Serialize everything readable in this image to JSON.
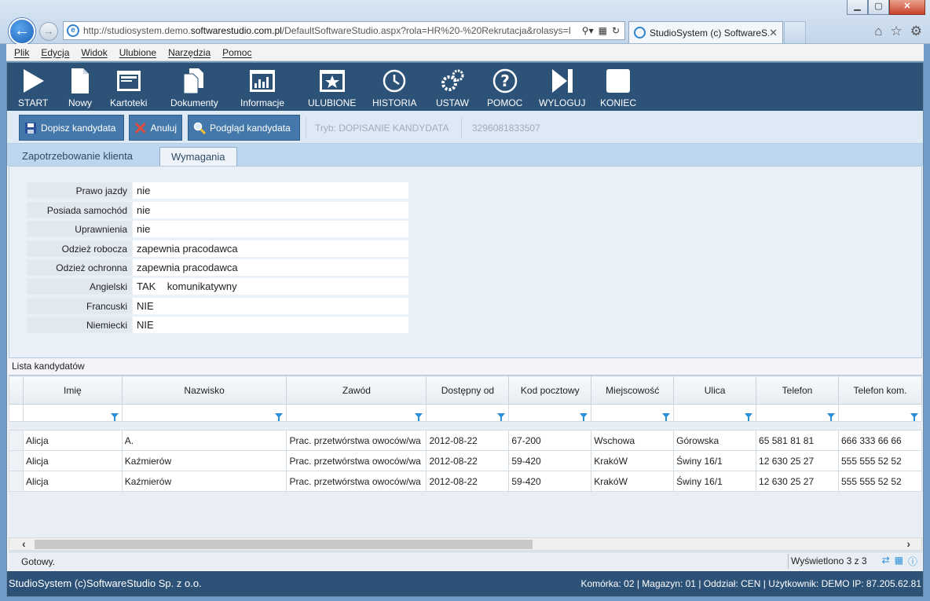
{
  "browser": {
    "url_prefix": "http://studiosystem.demo.",
    "url_domain": "softwarestudio.com.pl",
    "url_suffix": "/DefaultSoftwareStudio.aspx?rola=HR%20-%20Rekrutacja&rolasys=I",
    "tab_title": "StudioSystem (c) SoftwareS...",
    "tab_close": "✕",
    "minimize": "▁",
    "maximize": "▢",
    "close": "✕"
  },
  "menu": [
    "Plik",
    "Edycja",
    "Widok",
    "Ulubione",
    "Narzędzia",
    "Pomoc"
  ],
  "toolbar": [
    "START",
    "Nowy",
    "Kartoteki",
    "Dokumenty",
    "Informacje",
    "ULUBIONE",
    "HISTORIA",
    "USTAW",
    "POMOC",
    "WYLOGUJ",
    "KONIEC"
  ],
  "actions": {
    "add_candidate": "Dopisz kandydata",
    "cancel": "Anuluj",
    "preview": "Podgląd kandydata",
    "mode": "Tryb: DOPISANIE KANDYDATA",
    "record_id": "3296081833507"
  },
  "tabs": [
    "Zapotrzebowanie klienta",
    "Wymagania"
  ],
  "requirements": [
    {
      "label": "Prawo jazdy",
      "value": "nie"
    },
    {
      "label": "Posiada samochód",
      "value": "nie"
    },
    {
      "label": "Uprawnienia",
      "value": "nie"
    },
    {
      "label": "Odzież robocza",
      "value": "zapewnia pracodawca"
    },
    {
      "label": "Odzież ochronna",
      "value": "zapewnia pracodawca"
    },
    {
      "label": "Angielski",
      "value": "TAK    komunikatywny"
    },
    {
      "label": "Francuski",
      "value": "NIE"
    },
    {
      "label": "Niemiecki",
      "value": "NIE"
    }
  ],
  "list_title": "Lista kandydatów",
  "grid": {
    "columns": [
      "Imię",
      "Nazwisko",
      "Zawód",
      "Dostępny od",
      "Kod pocztowy",
      "Miejscowość",
      "Ulica",
      "Telefon",
      "Telefon kom."
    ],
    "rows": [
      [
        "Alicja",
        "A.",
        "Prac. przetwórstwa owoców/wa",
        "2012-08-22",
        "67-200",
        "Wschowa",
        "Górowska",
        "65 581 81 81",
        "666 333 66 66"
      ],
      [
        "Alicja",
        "Kaźmierów",
        "Prac. przetwórstwa owoców/wa",
        "2012-08-22",
        "59-420",
        "KrakóW",
        "Świny 16/1",
        "12 630 25 27",
        "555 555 52 52"
      ],
      [
        "Alicja",
        "Kaźmierów",
        "Prac. przetwórstwa owoców/wa",
        "2012-08-22",
        "59-420",
        "KrakóW",
        "Świny 16/1",
        "12 630 25 27",
        "555 555 52 52"
      ]
    ]
  },
  "status": {
    "ready": "Gotowy.",
    "count": "Wyświetlono 3 z 3"
  },
  "footer": {
    "company": "StudioSystem (c)SoftwareStudio Sp. z o.o.",
    "info": "Komórka: 02 | Magazyn: 01 | Oddział: CEN | Użytkownik: DEMO IP: 87.205.62.81"
  }
}
